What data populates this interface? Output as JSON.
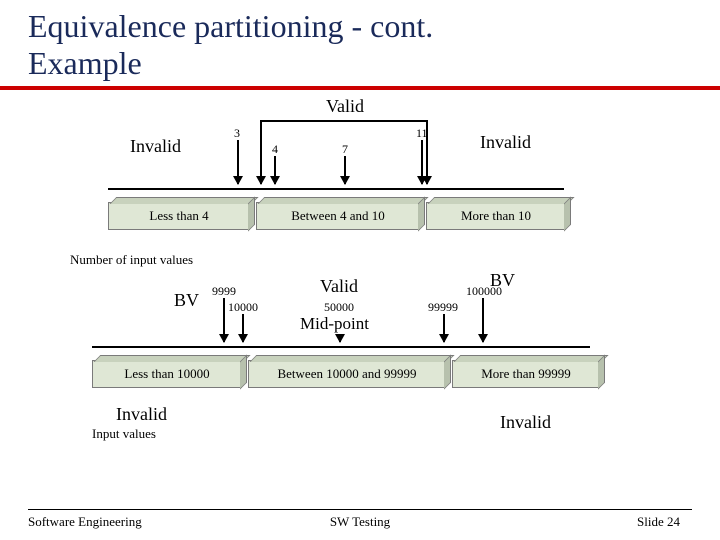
{
  "title_line1": "Equivalence partitioning -  cont.",
  "title_line2": "Example",
  "diagram1": {
    "valid": "Valid",
    "invalid_left": "Invalid",
    "invalid_right": "Invalid",
    "ticks": {
      "a": "3",
      "b": "4",
      "c": "7",
      "d": "11"
    },
    "boxes": {
      "left": "Less than 4",
      "mid": "Between 4 and 10",
      "right": "More than 10"
    },
    "axis_caption": "Number of input values"
  },
  "diagram2": {
    "valid": "Valid",
    "midpoint": "Mid-point",
    "bv_left": "BV",
    "bv_right": "BV",
    "invalid_left": "Invalid",
    "invalid_right": "Invalid",
    "ticks": {
      "a": "9999",
      "b": "10000",
      "c": "50000",
      "d": "99999",
      "e": "100000"
    },
    "boxes": {
      "left": "Less than 10000",
      "mid": "Between 10000 and 99999",
      "right": "More than 99999"
    },
    "axis_caption": "Input values"
  },
  "footer": {
    "left": "Software Engineering",
    "center": "SW Testing",
    "right": "Slide  24"
  },
  "chart_data": [
    {
      "type": "table",
      "title": "Equivalence partitions — number of input values",
      "partitions": [
        {
          "label": "Less than 4",
          "class": "Invalid"
        },
        {
          "label": "Between 4 and 10",
          "class": "Valid"
        },
        {
          "label": "More than 10",
          "class": "Invalid"
        }
      ],
      "boundary_and_test_values": [
        3,
        4,
        7,
        11
      ]
    },
    {
      "type": "table",
      "title": "Equivalence partitions — input values",
      "partitions": [
        {
          "label": "Less than 10000",
          "class": "Invalid"
        },
        {
          "label": "Between 10000 and 99999",
          "class": "Valid"
        },
        {
          "label": "More than 99999",
          "class": "Invalid"
        }
      ],
      "boundary_values": [
        9999,
        10000,
        99999,
        100000
      ],
      "mid_point": 50000
    }
  ]
}
